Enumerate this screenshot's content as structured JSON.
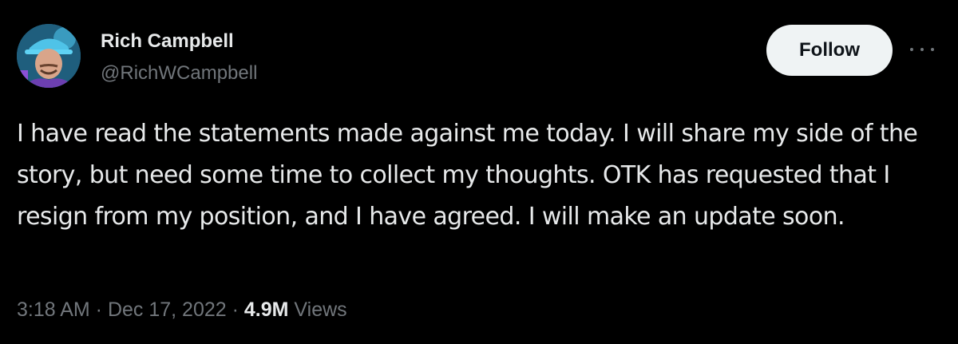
{
  "user": {
    "name": "Rich Campbell",
    "handle": "@RichWCampbell",
    "avatar_icon": "profile-photo"
  },
  "follow_label": "Follow",
  "more_icon": "ellipsis-icon",
  "tweet": {
    "text": "I have read the statements made against me today. I will share my side of the story, but need some time to collect my thoughts. OTK has requested that I resign from my position, and I have agreed. I will make an update soon."
  },
  "meta": {
    "time": "3:18 AM",
    "separator1": " · ",
    "date": "Dec 17, 2022",
    "separator2": " · ",
    "views_count": "4.9M",
    "views_label": " Views"
  },
  "colors": {
    "background": "#000000",
    "text_primary": "#e7e9ea",
    "text_secondary": "#71767b",
    "button_bg": "#eff3f4"
  }
}
